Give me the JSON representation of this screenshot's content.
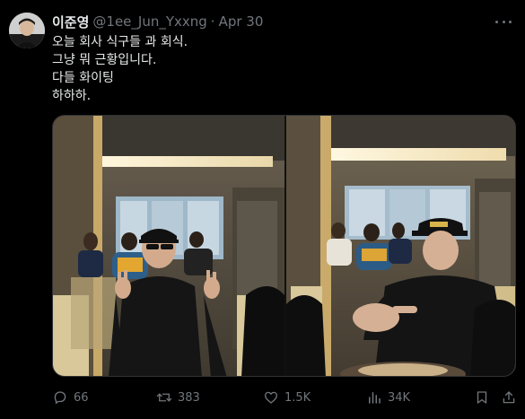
{
  "author": {
    "name": "이준영",
    "handle": "@1ee_Jun_Yxxng",
    "separator": "·",
    "date": "Apr 30"
  },
  "tweet_lines": [
    "오늘 회사 식구들 과 회식.",
    "그냥 뭐 근황입니다.",
    "다들 화이팅",
    "하하하."
  ],
  "metrics": {
    "replies": "66",
    "retweets": "383",
    "likes": "1.5K",
    "views": "34K"
  },
  "icons": {
    "more": "more-icon",
    "reply": "reply-icon",
    "retweet": "retweet-icon",
    "like": "heart-icon",
    "views": "views-icon",
    "bookmark": "bookmark-icon",
    "share": "share-icon"
  },
  "colors": {
    "background": "#000000",
    "text": "#e7e9ea",
    "muted": "#71767b",
    "border": "#2f3336"
  }
}
